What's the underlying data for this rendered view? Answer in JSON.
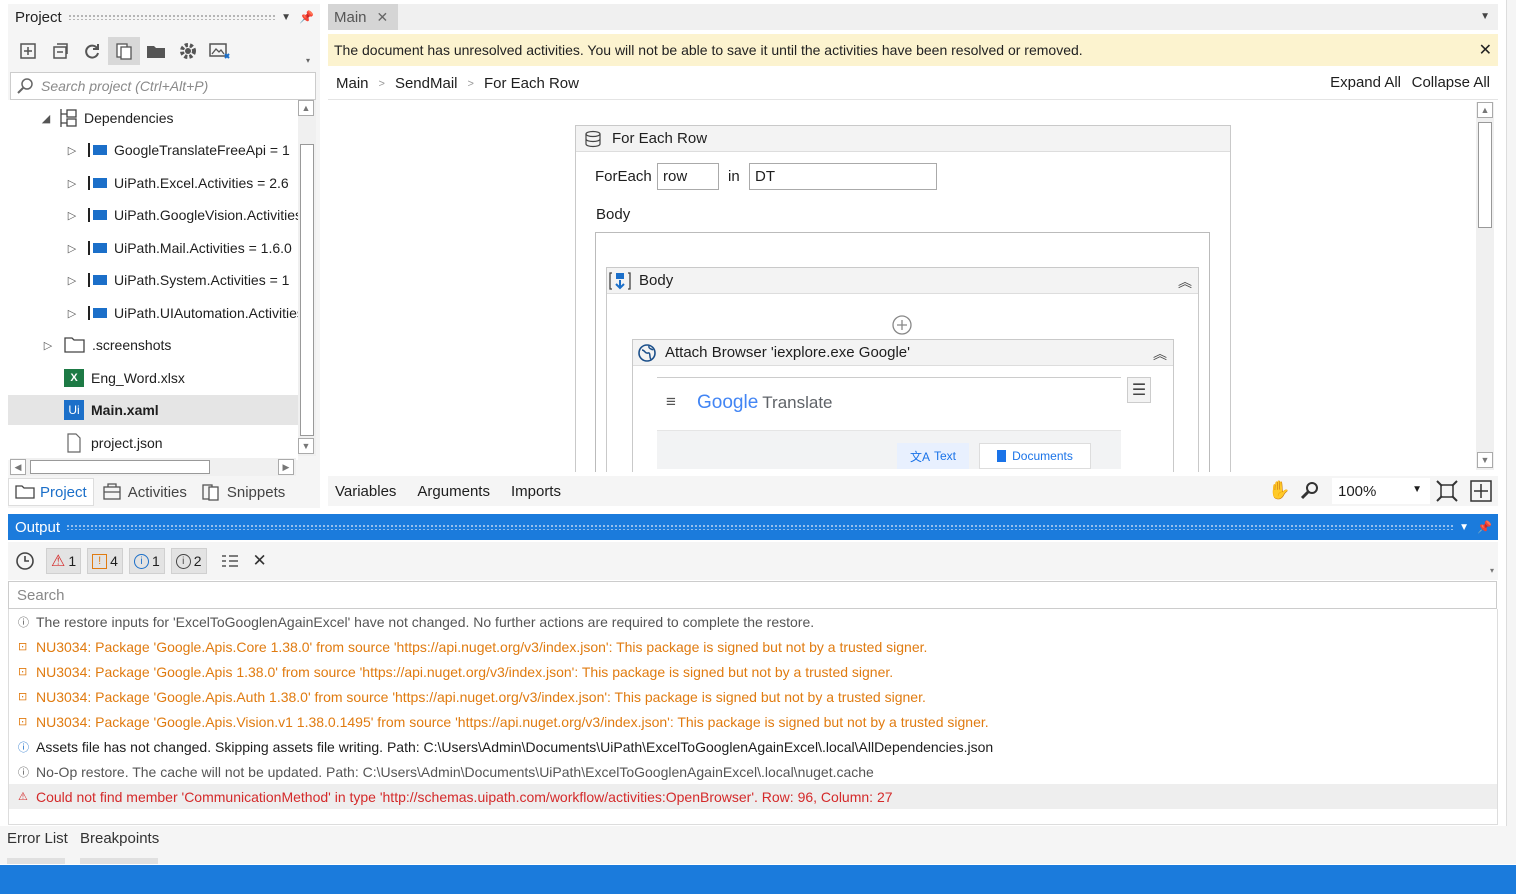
{
  "project_panel": {
    "title": "Project",
    "search_placeholder": "Search project (Ctrl+Alt+P)",
    "tree": {
      "dependencies_label": "Dependencies",
      "packages": [
        "GoogleTranslateFreeApi = 1",
        "UiPath.Excel.Activities = 2.6",
        "UiPath.GoogleVision.Activities",
        "UiPath.Mail.Activities = 1.6.0",
        "UiPath.System.Activities = 1",
        "UiPath.UIAutomation.Activities"
      ],
      "screenshots_folder": ".screenshots",
      "files": [
        "Eng_Word.xlsx",
        "Main.xaml",
        "project.json"
      ]
    },
    "bottom_tabs": [
      "Project",
      "Activities",
      "Snippets"
    ]
  },
  "designer": {
    "tab": "Main",
    "warning": "The document has unresolved activities. You will not be able to save it until the activities have been resolved or removed.",
    "breadcrumb": [
      "Main",
      "SendMail",
      "For Each Row"
    ],
    "expand_all": "Expand All",
    "collapse_all": "Collapse All",
    "foreach": {
      "title": "For Each Row",
      "foreach_label": "ForEach",
      "item_var": "row",
      "in_label": "in",
      "collection": "DT",
      "body_label": "Body"
    },
    "sequence_title": "Body",
    "attach_browser": {
      "title": "Attach Browser 'iexplore.exe Google'",
      "screenshot": {
        "brand_google": "Google",
        "brand_translate": "Translate",
        "tab_text": "Text",
        "tab_documents": "Documents"
      }
    },
    "bottom_tabs": [
      "Variables",
      "Arguments",
      "Imports"
    ],
    "zoom": "100%"
  },
  "output": {
    "title": "Output",
    "filters": {
      "errors": "1",
      "warnings": "4",
      "info": "1",
      "trace": "2"
    },
    "search_placeholder": "Search",
    "logs": [
      {
        "level": "trace",
        "text": "The restore inputs for 'ExcelToGooglenAgainExcel' have not changed. No further actions are required to complete the restore."
      },
      {
        "level": "warning",
        "text": "NU3034: Package 'Google.Apis.Core 1.38.0' from source 'https://api.nuget.org/v3/index.json': This package is signed but not by a trusted signer."
      },
      {
        "level": "warning",
        "text": "NU3034: Package 'Google.Apis 1.38.0' from source 'https://api.nuget.org/v3/index.json': This package is signed but not by a trusted signer."
      },
      {
        "level": "warning",
        "text": "NU3034: Package 'Google.Apis.Auth 1.38.0' from source 'https://api.nuget.org/v3/index.json': This package is signed but not by a trusted signer."
      },
      {
        "level": "warning",
        "text": "NU3034: Package 'Google.Apis.Vision.v1 1.38.0.1495' from source 'https://api.nuget.org/v3/index.json': This package is signed but not by a trusted signer."
      },
      {
        "level": "info",
        "text": "Assets file has not changed. Skipping assets file writing. Path: C:\\Users\\Admin\\Documents\\UiPath\\ExcelToGooglenAgainExcel\\.local\\AllDependencies.json"
      },
      {
        "level": "trace",
        "text": "No-Op restore. The cache will not be updated. Path: C:\\Users\\Admin\\Documents\\UiPath\\ExcelToGooglenAgainExcel\\.local\\nuget.cache"
      },
      {
        "level": "error",
        "text": "Could not find member 'CommunicationMethod' in type 'http://schemas.uipath.com/workflow/activities:OpenBrowser'. Row: 96, Column: 27"
      }
    ]
  },
  "bottom_tabs": [
    "Error List",
    "Breakpoints"
  ],
  "colors": {
    "accent": "#1b7bdc",
    "warning": "#e07b10",
    "error": "#d42a2a",
    "banner": "#fcf3cf"
  }
}
